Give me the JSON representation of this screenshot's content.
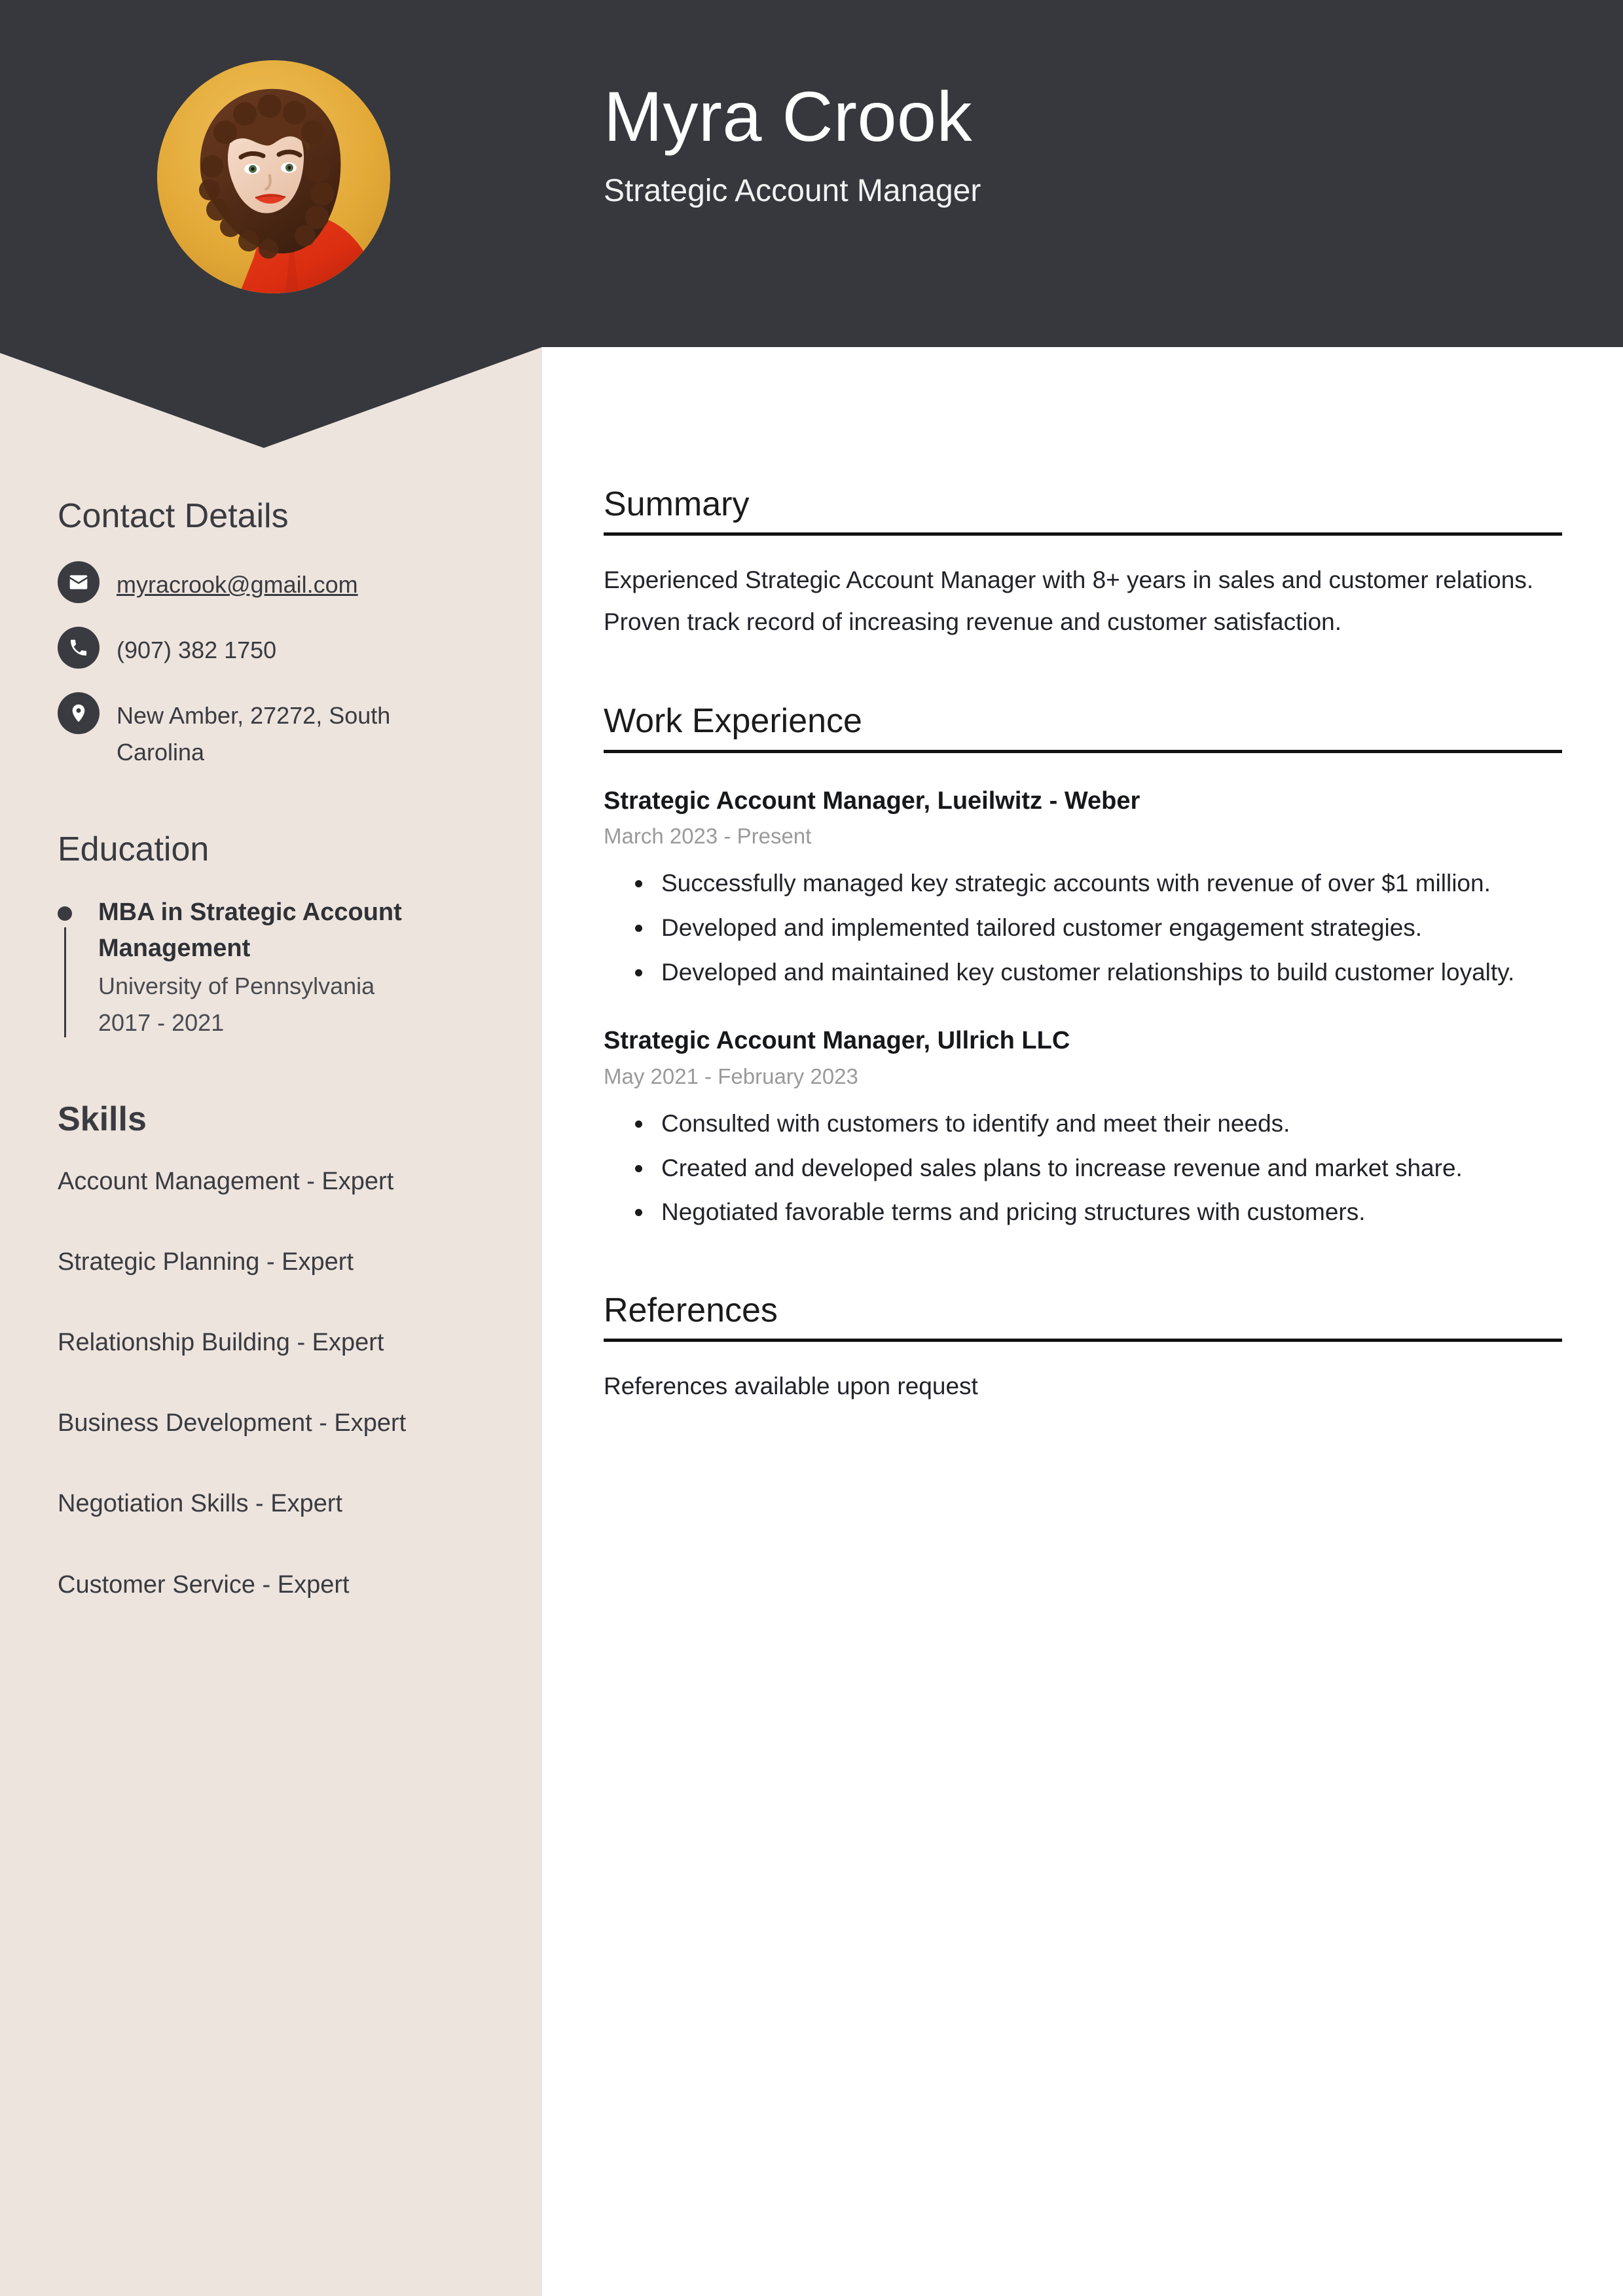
{
  "header": {
    "name": "Myra Crook",
    "job_title": "Strategic Account Manager",
    "avatar_alt": "portrait-photo",
    "background_color": "#36383d",
    "avatar_background_color": "#e2aa39"
  },
  "sidebar": {
    "background_color": "#ede4de",
    "contact": {
      "heading": "Contact Details",
      "items": [
        {
          "icon": "envelope-icon",
          "value": "myracrook@gmail.com",
          "is_link": true
        },
        {
          "icon": "phone-icon",
          "value": "(907) 382 1750",
          "is_link": false
        },
        {
          "icon": "location-pin-icon",
          "value": "New Amber, 27272, South Carolina",
          "is_link": false
        }
      ]
    },
    "education": {
      "heading": "Education",
      "items": [
        {
          "degree": "MBA in Strategic Account Management",
          "school": "University of Pennsylvania",
          "dates": "2017 - 2021"
        }
      ]
    },
    "skills": {
      "heading": "Skills",
      "items": [
        "Account Management - Expert",
        "Strategic Planning - Expert",
        "Relationship Building - Expert",
        "Business Development - Expert",
        "Negotiation Skills - Expert",
        "Customer Service - Expert"
      ]
    }
  },
  "main": {
    "summary": {
      "heading": "Summary",
      "text": "Experienced Strategic Account Manager with 8+ years in sales and customer relations. Proven track record of increasing revenue and customer satisfaction."
    },
    "work_experience": {
      "heading": "Work Experience",
      "jobs": [
        {
          "title": "Strategic Account Manager, Lueilwitz - Weber",
          "dates": "March 2023 - Present",
          "bullets": [
            "Successfully managed key strategic accounts with revenue of over $1 million.",
            "Developed and implemented tailored customer engagement strategies.",
            "Developed and maintained key customer relationships to build customer loyalty."
          ]
        },
        {
          "title": "Strategic Account Manager, Ullrich LLC",
          "dates": "May 2021 - February 2023",
          "bullets": [
            "Consulted with customers to identify and meet their needs.",
            "Created and developed sales plans to increase revenue and market share.",
            "Negotiated favorable terms and pricing structures with customers."
          ]
        }
      ]
    },
    "references": {
      "heading": "References",
      "text": "References available upon request"
    }
  }
}
